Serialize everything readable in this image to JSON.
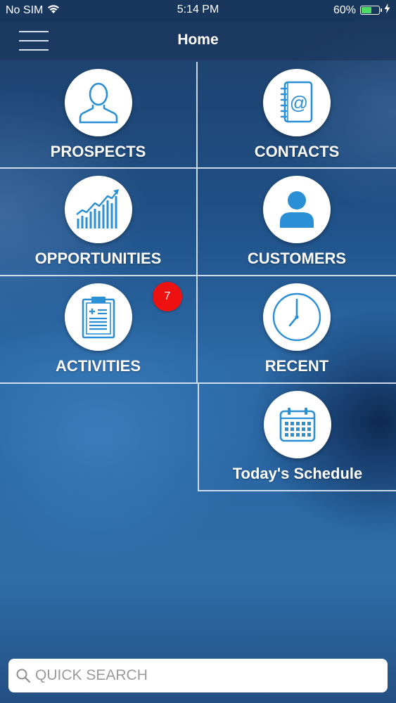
{
  "status_bar": {
    "carrier": "No SIM",
    "time": "5:14 PM",
    "battery_percent": "60%",
    "battery_level": 0.6,
    "wifi_icon": "wifi-icon",
    "charging_icon": "bolt-icon"
  },
  "nav": {
    "title": "Home",
    "menu_icon": "hamburger-menu-icon"
  },
  "tiles": [
    {
      "label": "PROSPECTS",
      "icon": "person-outline-icon"
    },
    {
      "label": "CONTACTS",
      "icon": "address-book-icon"
    },
    {
      "label": "OPPORTUNITIES",
      "icon": "growth-chart-icon"
    },
    {
      "label": "CUSTOMERS",
      "icon": "person-filled-icon"
    },
    {
      "label": "ACTIVITIES",
      "icon": "clipboard-icon",
      "badge": "7"
    },
    {
      "label": "RECENT",
      "icon": "clock-icon"
    },
    {
      "label": "Today's Schedule",
      "icon": "calendar-icon"
    }
  ],
  "search": {
    "placeholder": "QUICK SEARCH",
    "value": "",
    "icon": "search-icon"
  },
  "colors": {
    "icon_blue": "#2a8fd4",
    "badge_red": "#ee1111",
    "battery_green": "#4cd964"
  }
}
